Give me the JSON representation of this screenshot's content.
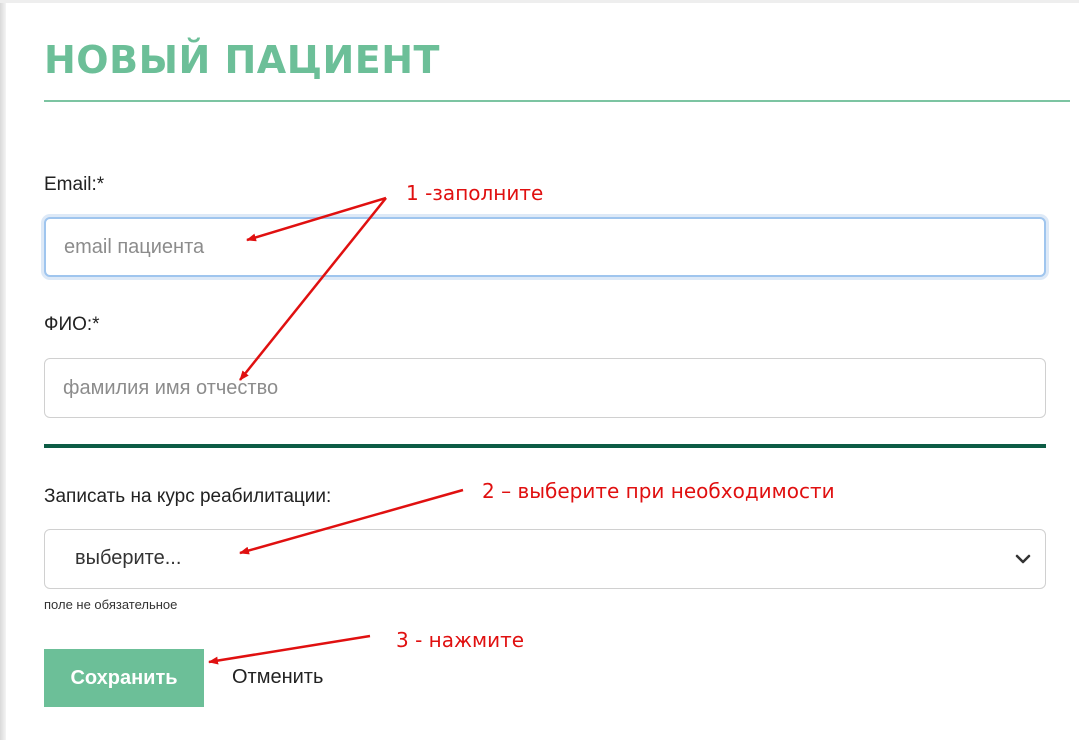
{
  "form": {
    "title": "НОВЫЙ ПАЦИЕНТ",
    "email_label": "Email:*",
    "email_placeholder": "email пациента",
    "fio_label": "ФИО:*",
    "fio_placeholder": "фамилия имя отчество",
    "course_label": "Записать на курс реабилитации:",
    "course_selected": "выберите...",
    "course_hint": "поле не обязательное",
    "save_label": "Сохранить",
    "cancel_label": "Отменить"
  },
  "annotations": {
    "step1": "1 -заполните",
    "step2": "2 – выберите при необходимости",
    "step3": "3 - нажмите"
  },
  "icons": {
    "select_chevron": "chevron-down-icon"
  },
  "colors": {
    "accent": "#6cbf98",
    "divider": "#0d5c45",
    "annotation": "#e01010",
    "focus": "#9fc5ee"
  }
}
